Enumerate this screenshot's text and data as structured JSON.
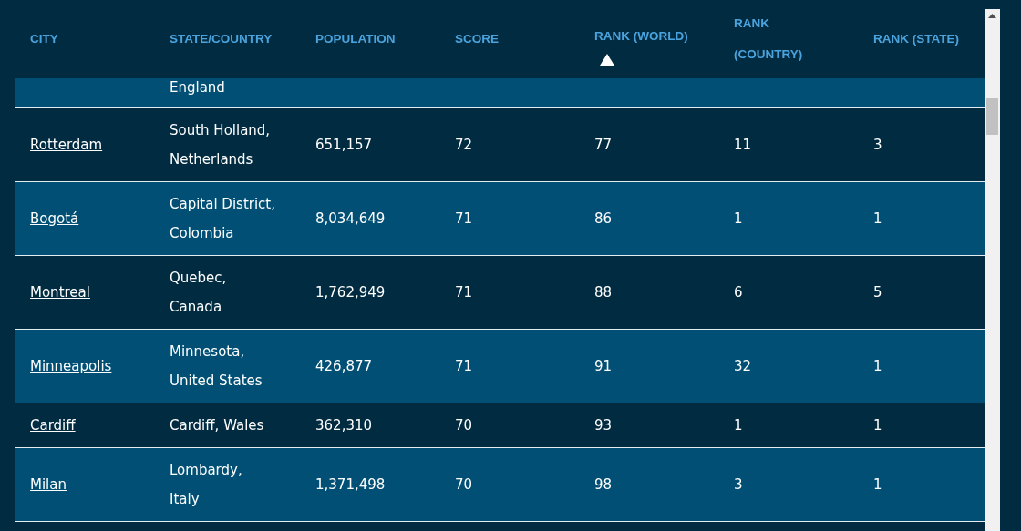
{
  "table": {
    "columns": [
      {
        "label": "CITY",
        "sorted": false
      },
      {
        "label": "STATE/COUNTRY",
        "sorted": false
      },
      {
        "label": "POPULATION",
        "sorted": false
      },
      {
        "label": "SCORE",
        "sorted": false
      },
      {
        "label": "RANK (WORLD)",
        "sorted": true
      },
      {
        "label": "RANK (COUNTRY)",
        "sorted": false
      },
      {
        "label": "RANK (STATE)",
        "sorted": false
      }
    ],
    "rows": [
      {
        "state": "England"
      },
      {
        "city": "Rotterdam",
        "state": "South Holland,\nNetherlands",
        "population": "651,157",
        "score": "72",
        "rank_world": "77",
        "rank_country": "11",
        "rank_state": "3"
      },
      {
        "city": "Bogotá",
        "state": "Capital District,\nColombia",
        "population": "8,034,649",
        "score": "71",
        "rank_world": "86",
        "rank_country": "1",
        "rank_state": "1"
      },
      {
        "city": "Montreal",
        "state": "Quebec,\nCanada",
        "population": "1,762,949",
        "score": "71",
        "rank_world": "88",
        "rank_country": "6",
        "rank_state": "5"
      },
      {
        "city": "Minneapolis",
        "state": "Minnesota,\nUnited States",
        "population": "426,877",
        "score": "71",
        "rank_world": "91",
        "rank_country": "32",
        "rank_state": "1"
      },
      {
        "city": "Cardiff",
        "state": "Cardiff, Wales",
        "population": "362,310",
        "score": "70",
        "rank_world": "93",
        "rank_country": "1",
        "rank_state": "1"
      },
      {
        "city": "Milan",
        "state": "Lombardy,\nItaly",
        "population": "1,371,498",
        "score": "70",
        "rank_world": "98",
        "rank_country": "3",
        "rank_state": "1"
      }
    ]
  }
}
